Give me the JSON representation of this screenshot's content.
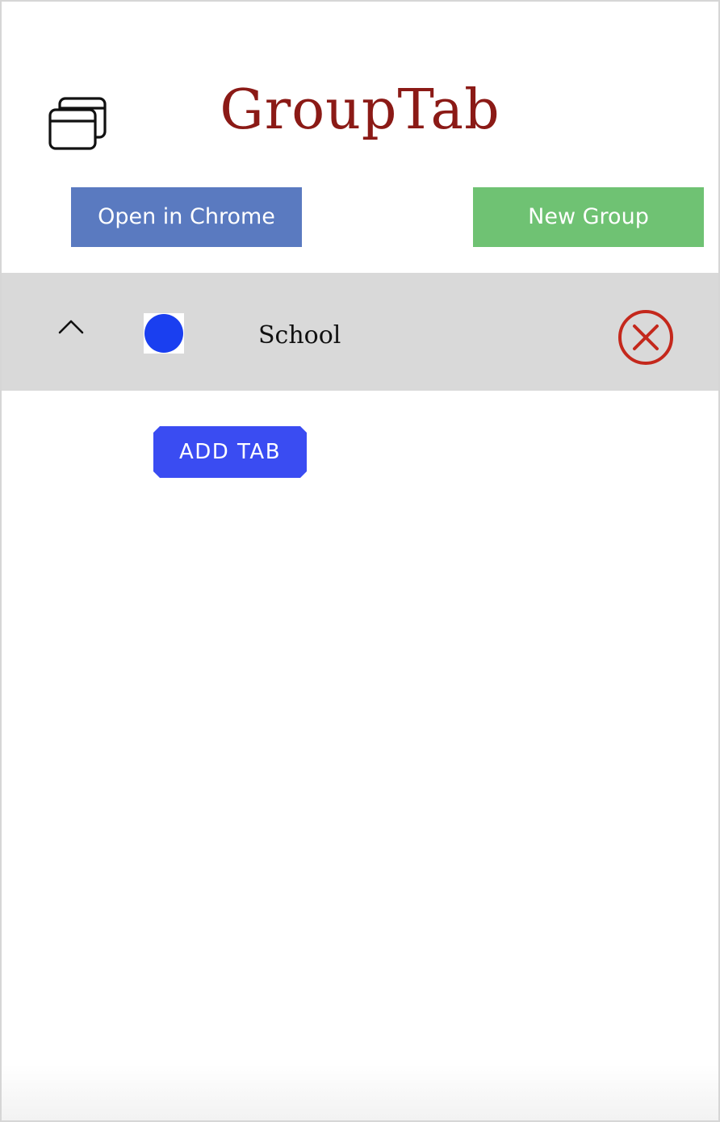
{
  "header": {
    "title": "GroupTab",
    "icon": "windows-stack-icon"
  },
  "toolbar": {
    "open_in_chrome_label": "Open in Chrome",
    "new_group_label": "New Group"
  },
  "groups": [
    {
      "name": "School",
      "color": "#1a3ff0",
      "expanded": true,
      "toggle_icon": "chevron-up-icon",
      "close_icon": "close-circle-icon",
      "add_tab_label": "ADD TAB"
    }
  ],
  "colors": {
    "title": "#8b1a16",
    "open_in_chrome_bg": "#5a7ac0",
    "new_group_bg": "#6fc273",
    "group_row_bg": "#d9d9d9",
    "close_icon": "#c4281c",
    "add_tab_bg": "#3a4cf2"
  }
}
